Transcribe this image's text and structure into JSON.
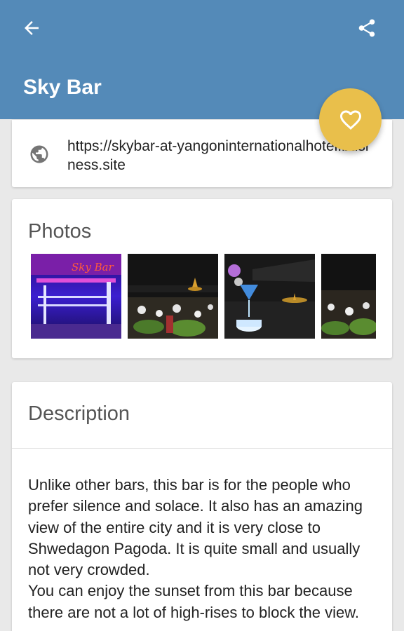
{
  "header": {
    "title": "Sky Bar"
  },
  "website": {
    "url": "https://skybar-at-yangoninternationalhotel.business.site"
  },
  "photos": {
    "heading": "Photos",
    "items": [
      "bar-counter-neon",
      "night-view-pagoda",
      "cocktail-glass",
      "night-view-pagoda-2"
    ]
  },
  "description": {
    "heading": "Description",
    "text": "Unlike other bars, this bar is for the people who prefer silence and solace. It also has an amazing view of the entire city and it is very close to Shwedagon Pagoda. It is quite small and usually not very crowded.\nYou can enjoy the sunset from this bar because there are not a lot of high-rises to block the view."
  },
  "colors": {
    "appbar": "#548ab8",
    "fab": "#e9bf4b",
    "background": "#e9e9e9"
  },
  "icons": {
    "back": "arrow-left-icon",
    "share": "share-icon",
    "favorite": "heart-outline-icon",
    "website": "globe-icon"
  }
}
